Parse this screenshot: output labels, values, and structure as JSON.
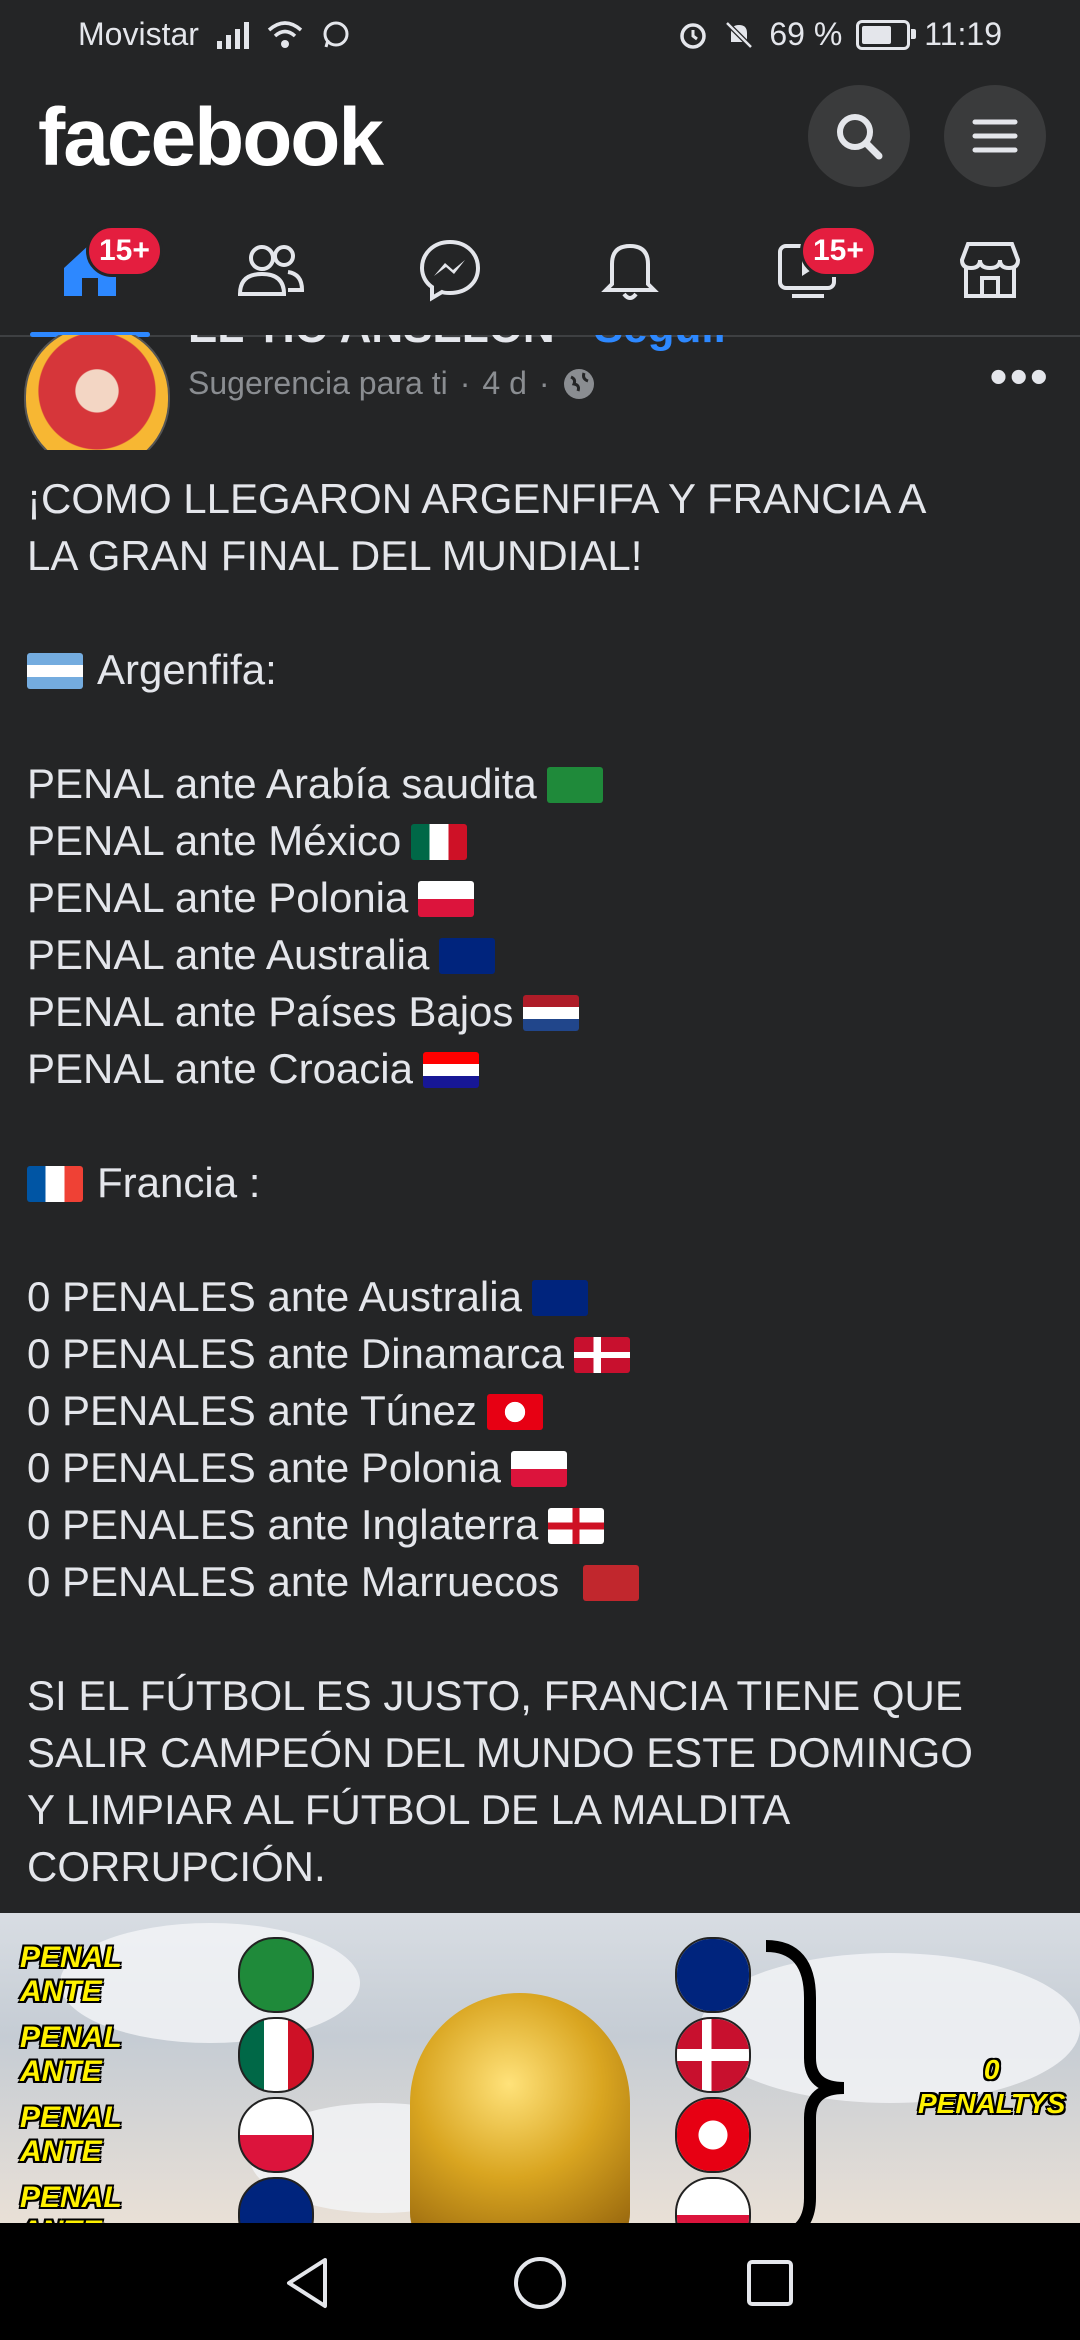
{
  "status_bar": {
    "carrier": "Movistar",
    "battery": "69 %",
    "battery_level": 0.69,
    "time": "11:19"
  },
  "app": {
    "logo": "facebook"
  },
  "nav": {
    "tabs": [
      {
        "name": "home",
        "badge": "15+"
      },
      {
        "name": "friends",
        "badge": ""
      },
      {
        "name": "messenger",
        "badge": ""
      },
      {
        "name": "notifications",
        "badge": ""
      },
      {
        "name": "watch",
        "badge": "15+"
      },
      {
        "name": "marketplace",
        "badge": ""
      }
    ]
  },
  "post": {
    "author": "EL TIO ANSELON",
    "separator": "·",
    "follow": "Seguir",
    "suggestion": "Sugerencia para ti",
    "time": "4 d",
    "title_line1": "¡COMO LLEGARON ARGENFIFA Y FRANCIA A",
    "title_line2": "LA GRAN FINAL DEL MUNDIAL!",
    "argentina_header": "Argenfifa:",
    "argentina_lines": [
      "PENAL ante Arabía saudita",
      "PENAL ante México",
      "PENAL ante Polonia",
      "PENAL ante Australia",
      "PENAL ante Países Bajos",
      "PENAL ante Croacia"
    ],
    "france_header": "Francia :",
    "france_lines": [
      "0 PENALES ante Australia",
      "0 PENALES ante Dinamarca",
      "0 PENALES ante Túnez",
      "0 PENALES ante Polonia",
      "0 PENALES ante Inglaterra",
      "0 PENALES ante Marruecos"
    ],
    "closing_line1": "SI EL FÚTBOL ES JUSTO, FRANCIA TIENE QUE",
    "closing_line2": "SALIR CAMPEÓN DEL MUNDO ESTE DOMINGO",
    "closing_line3": "Y LIMPIAR AL FÚTBOL DE LA MALDITA",
    "closing_line4": "CORRUPCIÓN."
  },
  "image": {
    "penal_label": "PENAL ANTE",
    "zero_line1": "0",
    "zero_line2": "PENALTYS"
  },
  "colors": {
    "accent": "#2d88ff",
    "badge": "#e41e3f",
    "background": "#242526"
  }
}
